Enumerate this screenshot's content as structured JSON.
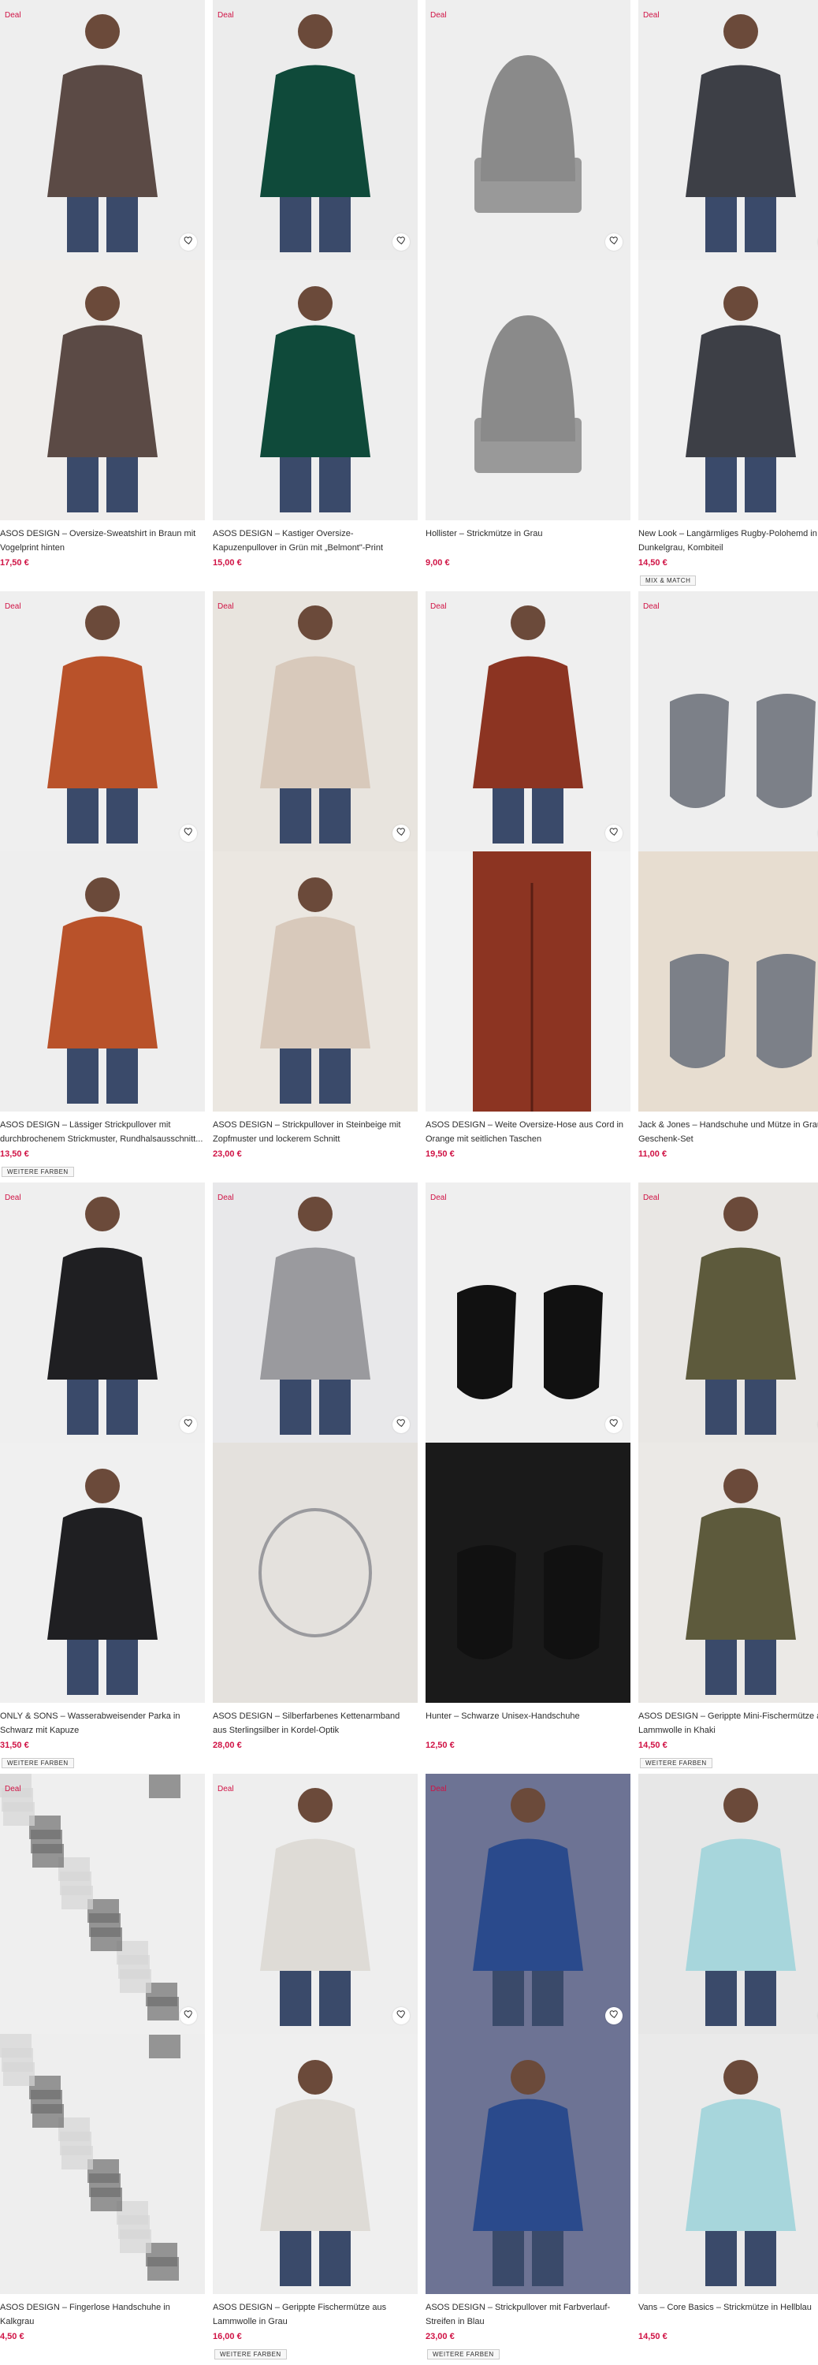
{
  "deal_label": "Deal",
  "wishlist_icon": "heart-icon",
  "products": [
    {
      "id": "p1",
      "deal": true,
      "title": "ASOS DESIGN – Oversize-Sweatshirt in Braun mit Vogelprint hinten",
      "price": "17,50 €",
      "badge": "",
      "colors": {
        "bg1": "#eeeeee",
        "bg2": "#f0eeec",
        "main": "#5b4a45"
      }
    },
    {
      "id": "p2",
      "deal": true,
      "title": "ASOS DESIGN – Kastiger Oversize-Kapuzenpullover in Grün mit „Belmont\"-Print",
      "price": "15,00 €",
      "badge": "",
      "colors": {
        "bg1": "#ececec",
        "bg2": "#eeeeee",
        "main": "#0f4a3a"
      }
    },
    {
      "id": "p3",
      "deal": true,
      "title": "Hollister – Strickmütze in Grau",
      "price": "9,00 €",
      "badge": "",
      "colors": {
        "bg1": "#eeeeee",
        "bg2": "#efefef",
        "main": "#8a8a8a"
      }
    },
    {
      "id": "p4",
      "deal": true,
      "title": "New Look – Langärmliges Rugby-Polohemd in Dunkelgrau, Kombiteil",
      "price": "14,50 €",
      "badge": "MIX & MATCH",
      "colors": {
        "bg1": "#eeeeee",
        "bg2": "#f0f0f0",
        "main": "#3d3f46"
      }
    },
    {
      "id": "p5",
      "deal": true,
      "title": "ASOS DESIGN – Lässiger Strickpullover mit durchbrochenem Strickmuster, Rundhalsausschnitt...",
      "price": "13,50 €",
      "badge": "WEITERE FARBEN",
      "colors": {
        "bg1": "#efefef",
        "bg2": "#eeeeee",
        "main": "#b9522a"
      }
    },
    {
      "id": "p6",
      "deal": true,
      "title": "ASOS DESIGN – Strickpullover in Steinbeige mit Zopfmuster und lockerem Schnitt",
      "price": "23,00 €",
      "badge": "",
      "colors": {
        "bg1": "#e8e4de",
        "bg2": "#ebe7e1",
        "main": "#d8c9bb"
      }
    },
    {
      "id": "p7",
      "deal": true,
      "title": "ASOS DESIGN – Weite Oversize-Hose aus Cord in Orange mit seitlichen Taschen",
      "price": "19,50 €",
      "badge": "",
      "colors": {
        "bg1": "#efefef",
        "bg2": "#f2f2f2",
        "main": "#8c3422"
      }
    },
    {
      "id": "p8",
      "deal": true,
      "title": "Jack & Jones – Handschuhe und Mütze in Grau im Geschenk-Set",
      "price": "11,00 €",
      "badge": "",
      "colors": {
        "bg1": "#eeeeee",
        "bg2": "#e7ddd0",
        "main": "#7c8088"
      }
    },
    {
      "id": "p9",
      "deal": true,
      "title": "ONLY & SONS – Wasserabweisender Parka in Schwarz mit Kapuze",
      "price": "31,50 €",
      "badge": "WEITERE FARBEN",
      "colors": {
        "bg1": "#efefef",
        "bg2": "#f0f0f0",
        "main": "#1f1f22"
      }
    },
    {
      "id": "p10",
      "deal": true,
      "title": "ASOS DESIGN – Silberfarbenes Kettenarmband aus Sterlingsilber in Kordel-Optik",
      "price": "28,00 €",
      "badge": "",
      "colors": {
        "bg1": "#e8e8ea",
        "bg2": "#e4e1dd",
        "main": "#9a9a9e"
      }
    },
    {
      "id": "p11",
      "deal": true,
      "title": "Hunter – Schwarze Unisex-Handschuhe",
      "price": "12,50 €",
      "badge": "",
      "colors": {
        "bg1": "#efefef",
        "bg2": "#1a1a1a",
        "main": "#111111"
      }
    },
    {
      "id": "p12",
      "deal": true,
      "title": "ASOS DESIGN – Gerippte Mini-Fischermütze aus Lammwolle in Khaki",
      "price": "14,50 €",
      "badge": "WEITERE FARBEN",
      "colors": {
        "bg1": "#e9e7e4",
        "bg2": "#ebe9e6",
        "main": "#5d5a3c"
      }
    },
    {
      "id": "p13",
      "deal": true,
      "title": "ASOS DESIGN – Fingerlose Handschuhe in Kalkgrau",
      "price": "4,50 €",
      "badge": "",
      "colors": {
        "bg1": "#efefef",
        "bg2": "#eeeeee",
        "main": "#6d6d6d"
      }
    },
    {
      "id": "p14",
      "deal": true,
      "title": "ASOS DESIGN – Gerippte Fischermütze aus Lammwolle in Grau",
      "price": "16,00 €",
      "badge": "WEITERE FARBEN",
      "colors": {
        "bg1": "#eeeeee",
        "bg2": "#efefef",
        "main": "#dedbd6"
      }
    },
    {
      "id": "p15",
      "deal": true,
      "title": "ASOS DESIGN – Strickpullover mit Farbverlauf-Streifen in Blau",
      "price": "23,00 €",
      "badge": "WEITERE FARBEN",
      "colors": {
        "bg1": "#6d7394",
        "bg2": "#6d7394",
        "main": "#2a4a8c"
      }
    },
    {
      "id": "p16",
      "deal": false,
      "title": "Vans – Core Basics – Strickmütze in Hellblau",
      "price": "14,50 €",
      "badge": "",
      "colors": {
        "bg1": "#e7e7e7",
        "bg2": "#eaeaea",
        "main": "#a7d6dc"
      }
    }
  ]
}
